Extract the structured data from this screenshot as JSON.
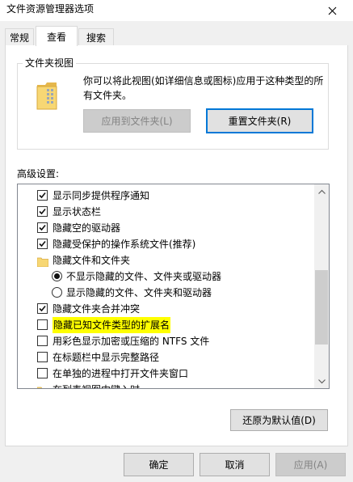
{
  "window": {
    "title": "文件资源管理器选项"
  },
  "tabs": [
    {
      "label": "常规",
      "active": false
    },
    {
      "label": "查看",
      "active": true
    },
    {
      "label": "搜索",
      "active": false
    }
  ],
  "folder_views": {
    "group_title": "文件夹视图",
    "description": "你可以将此视图(如详细信息或图标)应用于这种类型的所有文件夹。",
    "apply_button": "应用到文件夹(L)",
    "reset_button": "重置文件夹(R)"
  },
  "advanced": {
    "label": "高级设置:",
    "items": [
      {
        "type": "checkbox",
        "checked": true,
        "label": "显示同步提供程序通知"
      },
      {
        "type": "checkbox",
        "checked": true,
        "label": "显示状态栏"
      },
      {
        "type": "checkbox",
        "checked": true,
        "label": "隐藏空的驱动器"
      },
      {
        "type": "checkbox",
        "checked": true,
        "label": "隐藏受保护的操作系统文件(推荐)"
      },
      {
        "type": "folder",
        "label": "隐藏文件和文件夹"
      },
      {
        "type": "radio",
        "checked": true,
        "label": "不显示隐藏的文件、文件夹或驱动器"
      },
      {
        "type": "radio",
        "checked": false,
        "label": "显示隐藏的文件、文件夹和驱动器"
      },
      {
        "type": "checkbox",
        "checked": true,
        "label": "隐藏文件夹合并冲突"
      },
      {
        "type": "checkbox",
        "checked": false,
        "label": "隐藏已知文件类型的扩展名",
        "highlight": true
      },
      {
        "type": "checkbox",
        "checked": false,
        "label": "用彩色显示加密或压缩的 NTFS 文件"
      },
      {
        "type": "checkbox",
        "checked": false,
        "label": "在标题栏中显示完整路径"
      },
      {
        "type": "checkbox",
        "checked": false,
        "label": "在单独的进程中打开文件夹窗口"
      },
      {
        "type": "folder",
        "label": "在列表视图中键入时"
      }
    ],
    "restore_button": "还原为默认值(D)"
  },
  "footer": {
    "ok": "确定",
    "cancel": "取消",
    "apply": "应用(A)"
  },
  "colors": {
    "accent": "#0078d7",
    "highlight": "#ffff00",
    "folder": "#f7d774"
  },
  "icons": {
    "close": "close-icon",
    "folder_view": "folder-icon",
    "tree_folder": "folder-icon",
    "scroll_up": "chevron-up-icon",
    "scroll_down": "chevron-down-icon"
  }
}
